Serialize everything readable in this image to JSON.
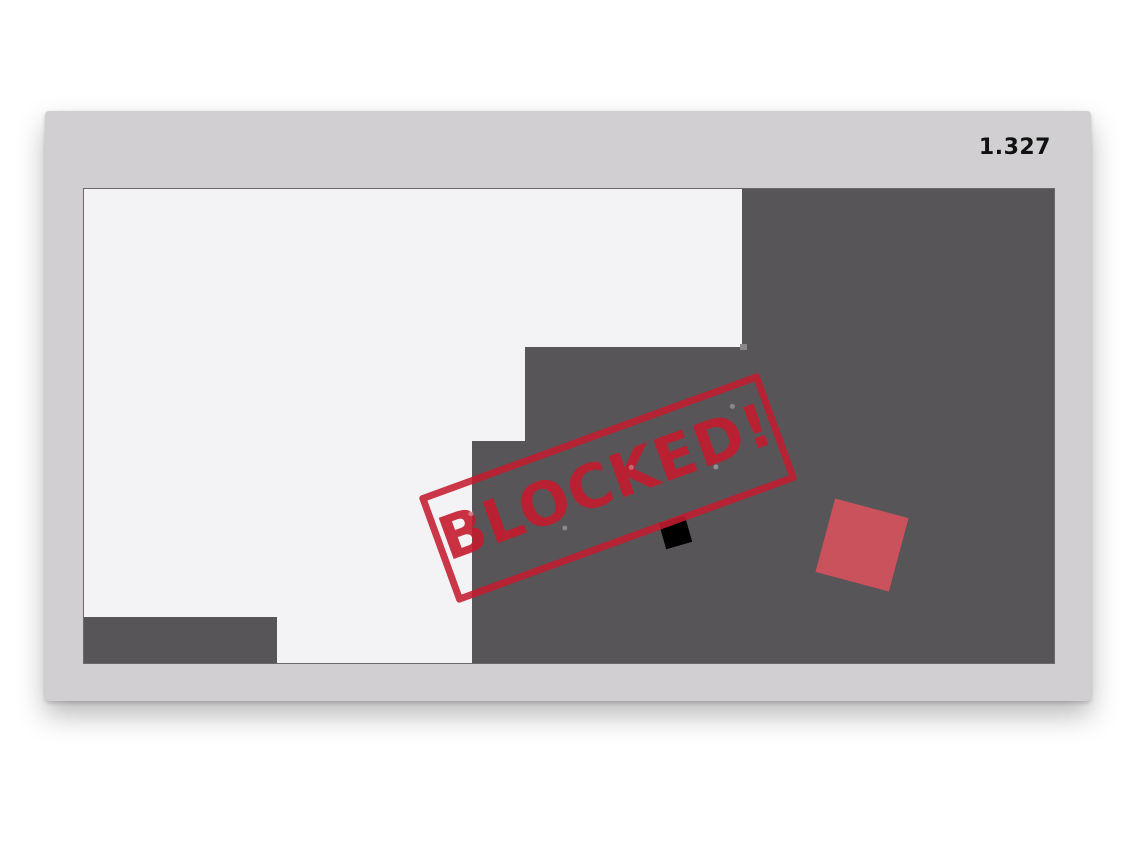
{
  "hud": {
    "score": "1.327"
  },
  "stamp": {
    "text": "BLOCKED!",
    "color": "#c41c30"
  },
  "colors": {
    "frame": "#d1cfd2",
    "board_background": "#f3f2f4",
    "wall": "#575557",
    "player": "#000000",
    "goal": "#c9525c"
  }
}
